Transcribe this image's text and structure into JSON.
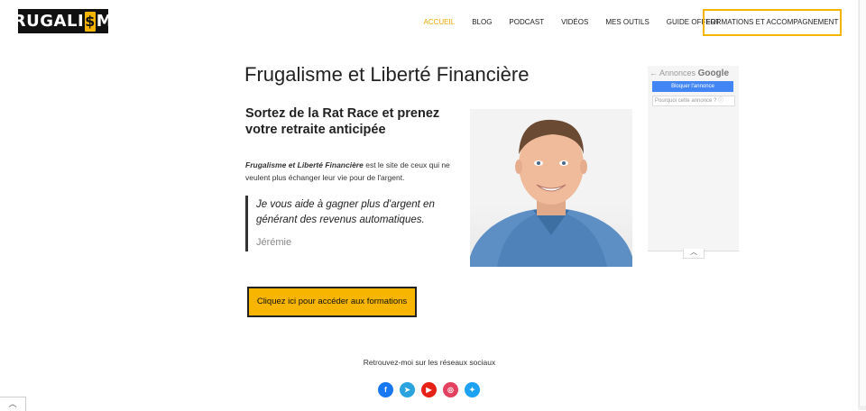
{
  "logo": {
    "prefix": "FRUGALI",
    "dollar": "$",
    "suffix": "ME"
  },
  "nav": {
    "items": [
      "ACCUEIL",
      "BLOG",
      "PODCAST",
      "VIDÉOS",
      "MES OUTILS",
      "GUIDE OFFERT"
    ],
    "active_index": 0,
    "cta": "FORMATIONS ET ACCOMPAGNEMENT"
  },
  "main": {
    "title": "Frugalisme et Liberté Financière",
    "subtitle": "Sortez de la Rat Race et prenez votre retraite anticipée",
    "intro_strong": "Frugalisme et Liberté Financière",
    "intro_rest": " est le site de ceux qui ne veulent plus échanger leur vie pour de l'argent.",
    "quote": "Je vous aide à gagner plus d'argent en générant des revenus automatiques.",
    "quote_author": "Jérémie",
    "cta_button": "Cliquez ici pour accéder aux formations",
    "social_text": "Retrouvez-moi sur les réseaux sociaux"
  },
  "social": [
    {
      "name": "facebook-icon",
      "glyph": "f",
      "color": "#1877f2"
    },
    {
      "name": "telegram-icon",
      "glyph": "➤",
      "color": "#2aa3df"
    },
    {
      "name": "youtube-icon",
      "glyph": "▶",
      "color": "#e62117"
    },
    {
      "name": "instagram-icon",
      "glyph": "◎",
      "color": "#e4405f"
    },
    {
      "name": "twitter-icon",
      "glyph": "✦",
      "color": "#1da1f2"
    }
  ],
  "ad": {
    "label": "Annonces",
    "brand": "Google",
    "block_button": "Bloquer l'annonce",
    "why": "Pourquoi cette annonce ? ⓘ"
  },
  "colors": {
    "accent": "#f5b400",
    "active_nav": "#f0a800"
  }
}
